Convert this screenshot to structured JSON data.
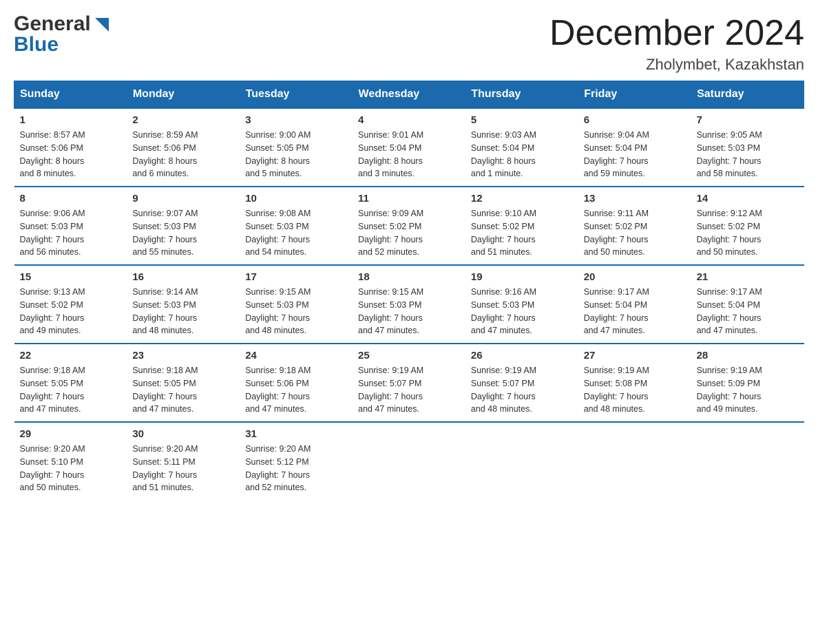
{
  "header": {
    "month_title": "December 2024",
    "location": "Zholymbet, Kazakhstan",
    "logo_general": "General",
    "logo_blue": "Blue"
  },
  "weekdays": [
    "Sunday",
    "Monday",
    "Tuesday",
    "Wednesday",
    "Thursday",
    "Friday",
    "Saturday"
  ],
  "weeks": [
    [
      {
        "day": "1",
        "sunrise": "Sunrise: 8:57 AM",
        "sunset": "Sunset: 5:06 PM",
        "daylight": "Daylight: 8 hours",
        "daylight2": "and 8 minutes."
      },
      {
        "day": "2",
        "sunrise": "Sunrise: 8:59 AM",
        "sunset": "Sunset: 5:06 PM",
        "daylight": "Daylight: 8 hours",
        "daylight2": "and 6 minutes."
      },
      {
        "day": "3",
        "sunrise": "Sunrise: 9:00 AM",
        "sunset": "Sunset: 5:05 PM",
        "daylight": "Daylight: 8 hours",
        "daylight2": "and 5 minutes."
      },
      {
        "day": "4",
        "sunrise": "Sunrise: 9:01 AM",
        "sunset": "Sunset: 5:04 PM",
        "daylight": "Daylight: 8 hours",
        "daylight2": "and 3 minutes."
      },
      {
        "day": "5",
        "sunrise": "Sunrise: 9:03 AM",
        "sunset": "Sunset: 5:04 PM",
        "daylight": "Daylight: 8 hours",
        "daylight2": "and 1 minute."
      },
      {
        "day": "6",
        "sunrise": "Sunrise: 9:04 AM",
        "sunset": "Sunset: 5:04 PM",
        "daylight": "Daylight: 7 hours",
        "daylight2": "and 59 minutes."
      },
      {
        "day": "7",
        "sunrise": "Sunrise: 9:05 AM",
        "sunset": "Sunset: 5:03 PM",
        "daylight": "Daylight: 7 hours",
        "daylight2": "and 58 minutes."
      }
    ],
    [
      {
        "day": "8",
        "sunrise": "Sunrise: 9:06 AM",
        "sunset": "Sunset: 5:03 PM",
        "daylight": "Daylight: 7 hours",
        "daylight2": "and 56 minutes."
      },
      {
        "day": "9",
        "sunrise": "Sunrise: 9:07 AM",
        "sunset": "Sunset: 5:03 PM",
        "daylight": "Daylight: 7 hours",
        "daylight2": "and 55 minutes."
      },
      {
        "day": "10",
        "sunrise": "Sunrise: 9:08 AM",
        "sunset": "Sunset: 5:03 PM",
        "daylight": "Daylight: 7 hours",
        "daylight2": "and 54 minutes."
      },
      {
        "day": "11",
        "sunrise": "Sunrise: 9:09 AM",
        "sunset": "Sunset: 5:02 PM",
        "daylight": "Daylight: 7 hours",
        "daylight2": "and 52 minutes."
      },
      {
        "day": "12",
        "sunrise": "Sunrise: 9:10 AM",
        "sunset": "Sunset: 5:02 PM",
        "daylight": "Daylight: 7 hours",
        "daylight2": "and 51 minutes."
      },
      {
        "day": "13",
        "sunrise": "Sunrise: 9:11 AM",
        "sunset": "Sunset: 5:02 PM",
        "daylight": "Daylight: 7 hours",
        "daylight2": "and 50 minutes."
      },
      {
        "day": "14",
        "sunrise": "Sunrise: 9:12 AM",
        "sunset": "Sunset: 5:02 PM",
        "daylight": "Daylight: 7 hours",
        "daylight2": "and 50 minutes."
      }
    ],
    [
      {
        "day": "15",
        "sunrise": "Sunrise: 9:13 AM",
        "sunset": "Sunset: 5:02 PM",
        "daylight": "Daylight: 7 hours",
        "daylight2": "and 49 minutes."
      },
      {
        "day": "16",
        "sunrise": "Sunrise: 9:14 AM",
        "sunset": "Sunset: 5:03 PM",
        "daylight": "Daylight: 7 hours",
        "daylight2": "and 48 minutes."
      },
      {
        "day": "17",
        "sunrise": "Sunrise: 9:15 AM",
        "sunset": "Sunset: 5:03 PM",
        "daylight": "Daylight: 7 hours",
        "daylight2": "and 48 minutes."
      },
      {
        "day": "18",
        "sunrise": "Sunrise: 9:15 AM",
        "sunset": "Sunset: 5:03 PM",
        "daylight": "Daylight: 7 hours",
        "daylight2": "and 47 minutes."
      },
      {
        "day": "19",
        "sunrise": "Sunrise: 9:16 AM",
        "sunset": "Sunset: 5:03 PM",
        "daylight": "Daylight: 7 hours",
        "daylight2": "and 47 minutes."
      },
      {
        "day": "20",
        "sunrise": "Sunrise: 9:17 AM",
        "sunset": "Sunset: 5:04 PM",
        "daylight": "Daylight: 7 hours",
        "daylight2": "and 47 minutes."
      },
      {
        "day": "21",
        "sunrise": "Sunrise: 9:17 AM",
        "sunset": "Sunset: 5:04 PM",
        "daylight": "Daylight: 7 hours",
        "daylight2": "and 47 minutes."
      }
    ],
    [
      {
        "day": "22",
        "sunrise": "Sunrise: 9:18 AM",
        "sunset": "Sunset: 5:05 PM",
        "daylight": "Daylight: 7 hours",
        "daylight2": "and 47 minutes."
      },
      {
        "day": "23",
        "sunrise": "Sunrise: 9:18 AM",
        "sunset": "Sunset: 5:05 PM",
        "daylight": "Daylight: 7 hours",
        "daylight2": "and 47 minutes."
      },
      {
        "day": "24",
        "sunrise": "Sunrise: 9:18 AM",
        "sunset": "Sunset: 5:06 PM",
        "daylight": "Daylight: 7 hours",
        "daylight2": "and 47 minutes."
      },
      {
        "day": "25",
        "sunrise": "Sunrise: 9:19 AM",
        "sunset": "Sunset: 5:07 PM",
        "daylight": "Daylight: 7 hours",
        "daylight2": "and 47 minutes."
      },
      {
        "day": "26",
        "sunrise": "Sunrise: 9:19 AM",
        "sunset": "Sunset: 5:07 PM",
        "daylight": "Daylight: 7 hours",
        "daylight2": "and 48 minutes."
      },
      {
        "day": "27",
        "sunrise": "Sunrise: 9:19 AM",
        "sunset": "Sunset: 5:08 PM",
        "daylight": "Daylight: 7 hours",
        "daylight2": "and 48 minutes."
      },
      {
        "day": "28",
        "sunrise": "Sunrise: 9:19 AM",
        "sunset": "Sunset: 5:09 PM",
        "daylight": "Daylight: 7 hours",
        "daylight2": "and 49 minutes."
      }
    ],
    [
      {
        "day": "29",
        "sunrise": "Sunrise: 9:20 AM",
        "sunset": "Sunset: 5:10 PM",
        "daylight": "Daylight: 7 hours",
        "daylight2": "and 50 minutes."
      },
      {
        "day": "30",
        "sunrise": "Sunrise: 9:20 AM",
        "sunset": "Sunset: 5:11 PM",
        "daylight": "Daylight: 7 hours",
        "daylight2": "and 51 minutes."
      },
      {
        "day": "31",
        "sunrise": "Sunrise: 9:20 AM",
        "sunset": "Sunset: 5:12 PM",
        "daylight": "Daylight: 7 hours",
        "daylight2": "and 52 minutes."
      },
      {
        "day": "",
        "sunrise": "",
        "sunset": "",
        "daylight": "",
        "daylight2": ""
      },
      {
        "day": "",
        "sunrise": "",
        "sunset": "",
        "daylight": "",
        "daylight2": ""
      },
      {
        "day": "",
        "sunrise": "",
        "sunset": "",
        "daylight": "",
        "daylight2": ""
      },
      {
        "day": "",
        "sunrise": "",
        "sunset": "",
        "daylight": "",
        "daylight2": ""
      }
    ]
  ]
}
